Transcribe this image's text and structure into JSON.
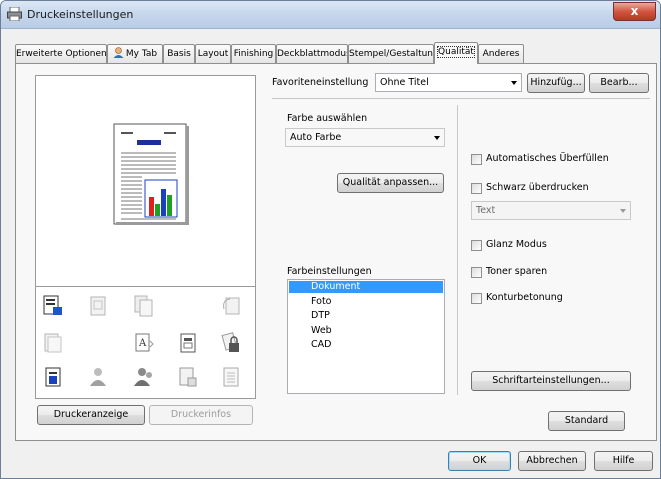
{
  "window": {
    "title": "Druckeinstellungen",
    "close_glyph": "x"
  },
  "tabs": [
    {
      "label": "Erweiterte Optionen"
    },
    {
      "label": "My Tab"
    },
    {
      "label": "Basis"
    },
    {
      "label": "Layout"
    },
    {
      "label": "Finishing"
    },
    {
      "label": "Deckblattmodus"
    },
    {
      "label": "Stempel/Gestaltung"
    },
    {
      "label": "Qualität"
    },
    {
      "label": "Anderes"
    }
  ],
  "active_tab": "Qualität",
  "favorites": {
    "label": "Favoriteneinstellung",
    "value": "Ohne Titel",
    "add_button": "Hinzufüg...",
    "edit_button": "Bearb..."
  },
  "color_select": {
    "label": "Farbe auswählen",
    "value": "Auto Farbe"
  },
  "adjust_quality_button": "Qualität anpassen...",
  "color_settings": {
    "label": "Farbeinstellungen",
    "items": [
      "Dokument",
      "Foto",
      "DTP",
      "Web",
      "CAD"
    ],
    "selected": "Dokument"
  },
  "options": {
    "auto_trapping": {
      "label": "Automatisches Überfüllen",
      "checked": false
    },
    "black_overprint": {
      "label": "Schwarz überdrucken",
      "checked": false
    },
    "overprint_mode": {
      "value": "Text",
      "enabled": false
    },
    "gloss_mode": {
      "label": "Glanz Modus",
      "checked": false
    },
    "toner_save": {
      "label": "Toner sparen",
      "checked": false
    },
    "edge_enhance": {
      "label": "Konturbetonung",
      "checked": false
    }
  },
  "font_settings_button": "Schriftarteinstellungen...",
  "standard_button": "Standard",
  "printer_view_button": "Druckeranzeige",
  "printer_info_button": "Druckerinfos",
  "footer": {
    "ok": "OK",
    "cancel": "Abbrechen",
    "help": "Hilfe"
  },
  "colors": {
    "accent_blue": "#3399ff",
    "preview_bar_red": "#e02020",
    "preview_bar_green": "#20a020",
    "preview_bar_blue": "#1a3fbf"
  }
}
